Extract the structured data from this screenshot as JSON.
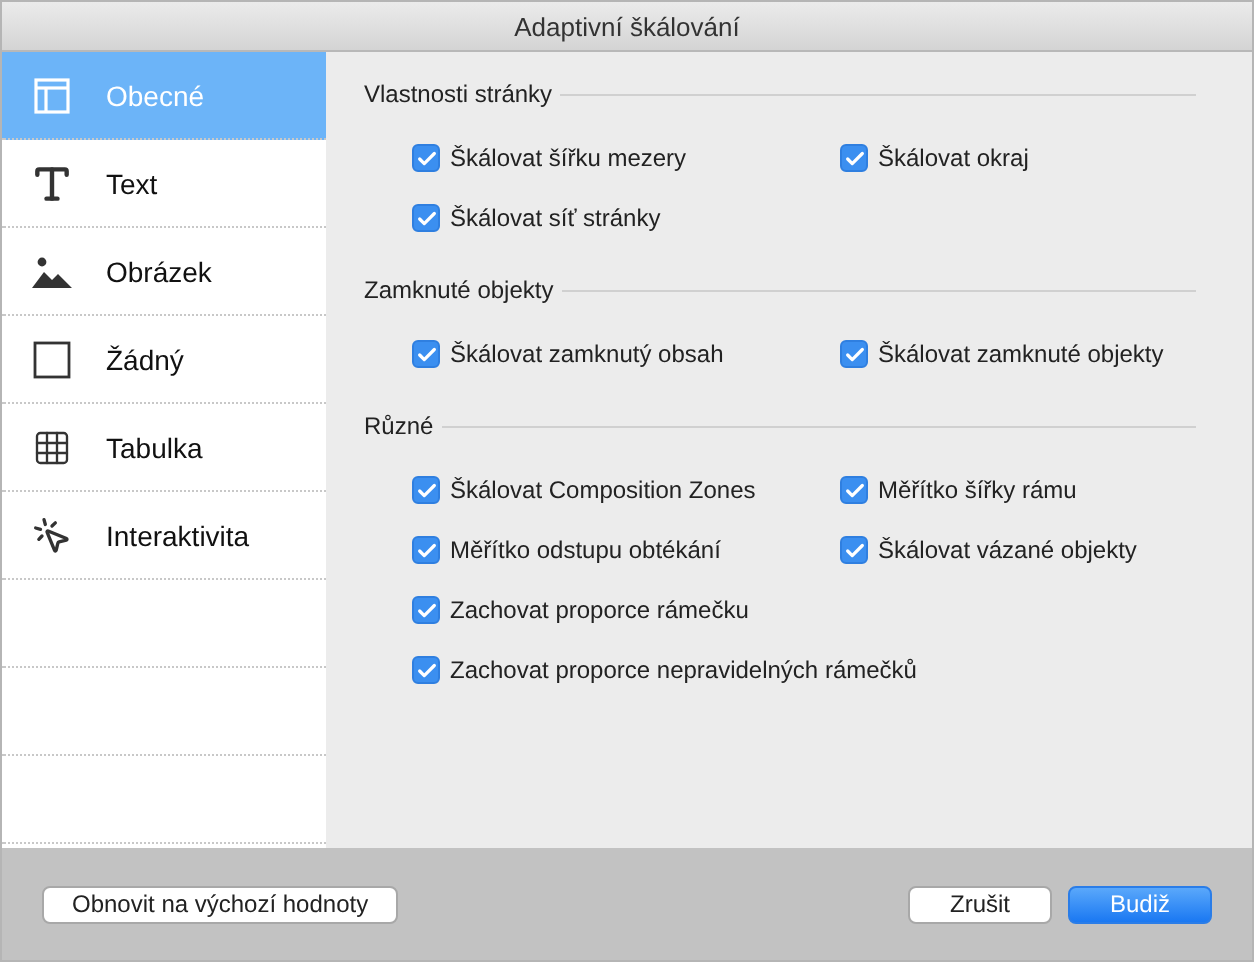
{
  "window": {
    "title": "Adaptivní škálování"
  },
  "sidebar": {
    "items": [
      {
        "label": "Obecné",
        "selected": true
      },
      {
        "label": "Text",
        "selected": false
      },
      {
        "label": "Obrázek",
        "selected": false
      },
      {
        "label": "Žádný",
        "selected": false
      },
      {
        "label": "Tabulka",
        "selected": false
      },
      {
        "label": "Interaktivita",
        "selected": false
      }
    ]
  },
  "sections": [
    {
      "title": "Vlastnosti stránky",
      "rows": [
        [
          {
            "label": "Škálovat šířku mezery",
            "checked": true
          },
          {
            "label": "Škálovat okraj",
            "checked": true
          }
        ],
        [
          {
            "label": "Škálovat síť stránky",
            "checked": true
          }
        ]
      ]
    },
    {
      "title": "Zamknuté objekty",
      "rows": [
        [
          {
            "label": "Škálovat zamknutý obsah",
            "checked": true
          },
          {
            "label": "Škálovat zamknuté objekty",
            "checked": true
          }
        ]
      ]
    },
    {
      "title": "Různé",
      "rows": [
        [
          {
            "label": "Škálovat Composition Zones",
            "checked": true
          },
          {
            "label": "Měřítko šířky rámu",
            "checked": true
          }
        ],
        [
          {
            "label": "Měřítko odstupu obtékání",
            "checked": true
          },
          {
            "label": "Škálovat vázané objekty",
            "checked": true
          }
        ],
        [
          {
            "label": "Zachovat proporce rámečku",
            "checked": true
          }
        ],
        [
          {
            "label": "Zachovat proporce nepravidelných rámečků",
            "checked": true
          }
        ]
      ]
    }
  ],
  "footer": {
    "reset": "Obnovit na výchozí hodnoty",
    "buttons": [
      {
        "label": "Zrušit",
        "default": false
      },
      {
        "label": "Budiž",
        "default": true
      }
    ]
  }
}
